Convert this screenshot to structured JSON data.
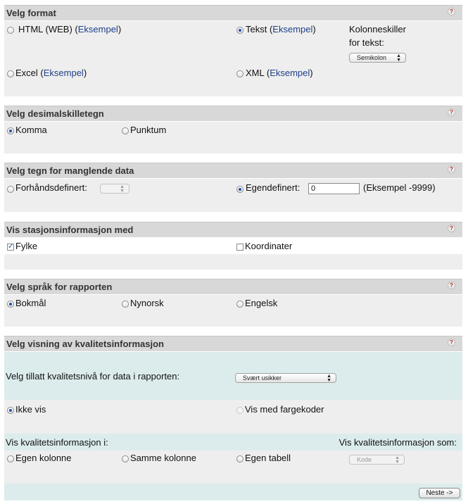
{
  "help_glyph": "?",
  "format": {
    "title": "Velg format",
    "html_label": "HTML (WEB) (",
    "text_label": "Tekst (",
    "excel_label": "Excel (",
    "xml_label": "XML (",
    "example_link": "Eksempel",
    "close_paren": ")",
    "separator_label_1": "Kolonneskiller",
    "separator_label_2": "for tekst:",
    "separator_value": "Semikolon",
    "selected": "Tekst"
  },
  "decimal": {
    "title": "Velg desimalskilletegn",
    "comma": "Komma",
    "point": "Punktum",
    "selected": "Komma"
  },
  "missing": {
    "title": "Velg tegn for manglende data",
    "predefined": "Forhåndsdefinert:",
    "custom": "Egendefinert:",
    "custom_value": "0",
    "example": "(Eksempel -9999)",
    "selected": "Egendefinert"
  },
  "station": {
    "title": "Vis stasjonsinformasjon med",
    "county": "Fylke",
    "coordinates": "Koordinater",
    "county_checked": true,
    "coordinates_checked": false
  },
  "language": {
    "title": "Velg språk for rapporten",
    "bokmal": "Bokmål",
    "nynorsk": "Nynorsk",
    "english": "Engelsk",
    "selected": "Bokmål"
  },
  "quality": {
    "title": "Velg visning av kvalitetsinformasjon",
    "level_label": "Velg tillatt kvalitetsnivå for data i rapporten:",
    "level_value": "Svært usikker",
    "hide": "Ikke vis",
    "color_codes": "Vis med fargekoder",
    "show_in_label": "Vis kvalitetsinformasjon i:",
    "show_as_label": "Vis kvalitetsinformasjon som:",
    "own_column": "Egen kolonne",
    "same_column": "Samme kolonne",
    "own_table": "Egen tabell",
    "show_as_value": "Kode",
    "selected": "Ikke vis"
  },
  "next_button": "Neste ->"
}
